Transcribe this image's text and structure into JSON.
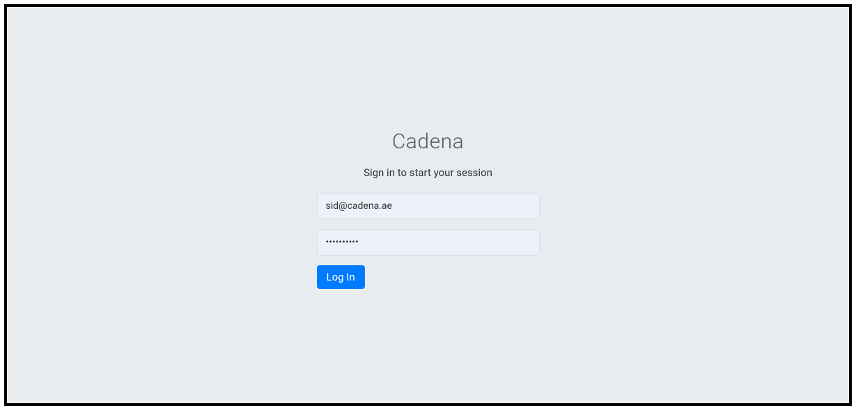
{
  "brand": "Cadena",
  "subtitle": "Sign in to start your session",
  "form": {
    "email_value": "sid@cadena.ae",
    "password_value": "••••••••••",
    "login_label": "Log In"
  }
}
